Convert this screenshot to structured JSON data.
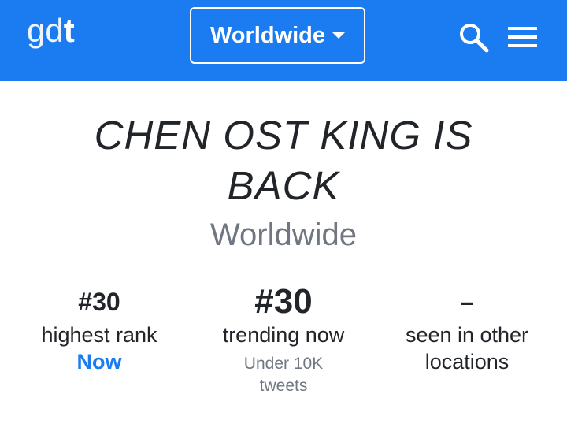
{
  "header": {
    "logo_part1": "g",
    "logo_part2": "d",
    "logo_part3": "t",
    "region_label": "Worldwide",
    "search_icon": "search-icon",
    "menu_icon": "hamburger-menu-icon",
    "colors": {
      "bar": "#1a7cf0",
      "text": "#ffffff"
    }
  },
  "trend": {
    "title_line1": "CHEN OST KING IS",
    "title_line2": "BACK",
    "location": "Worldwide"
  },
  "stats": {
    "highest": {
      "value": "#30",
      "label": "highest rank",
      "when": "Now"
    },
    "trending": {
      "value": "#30",
      "label": "trending now",
      "volume_line1": "Under 10K",
      "volume_line2": "tweets"
    },
    "other": {
      "value": "–",
      "label_line1": "seen in other",
      "label_line2": "locations"
    }
  }
}
